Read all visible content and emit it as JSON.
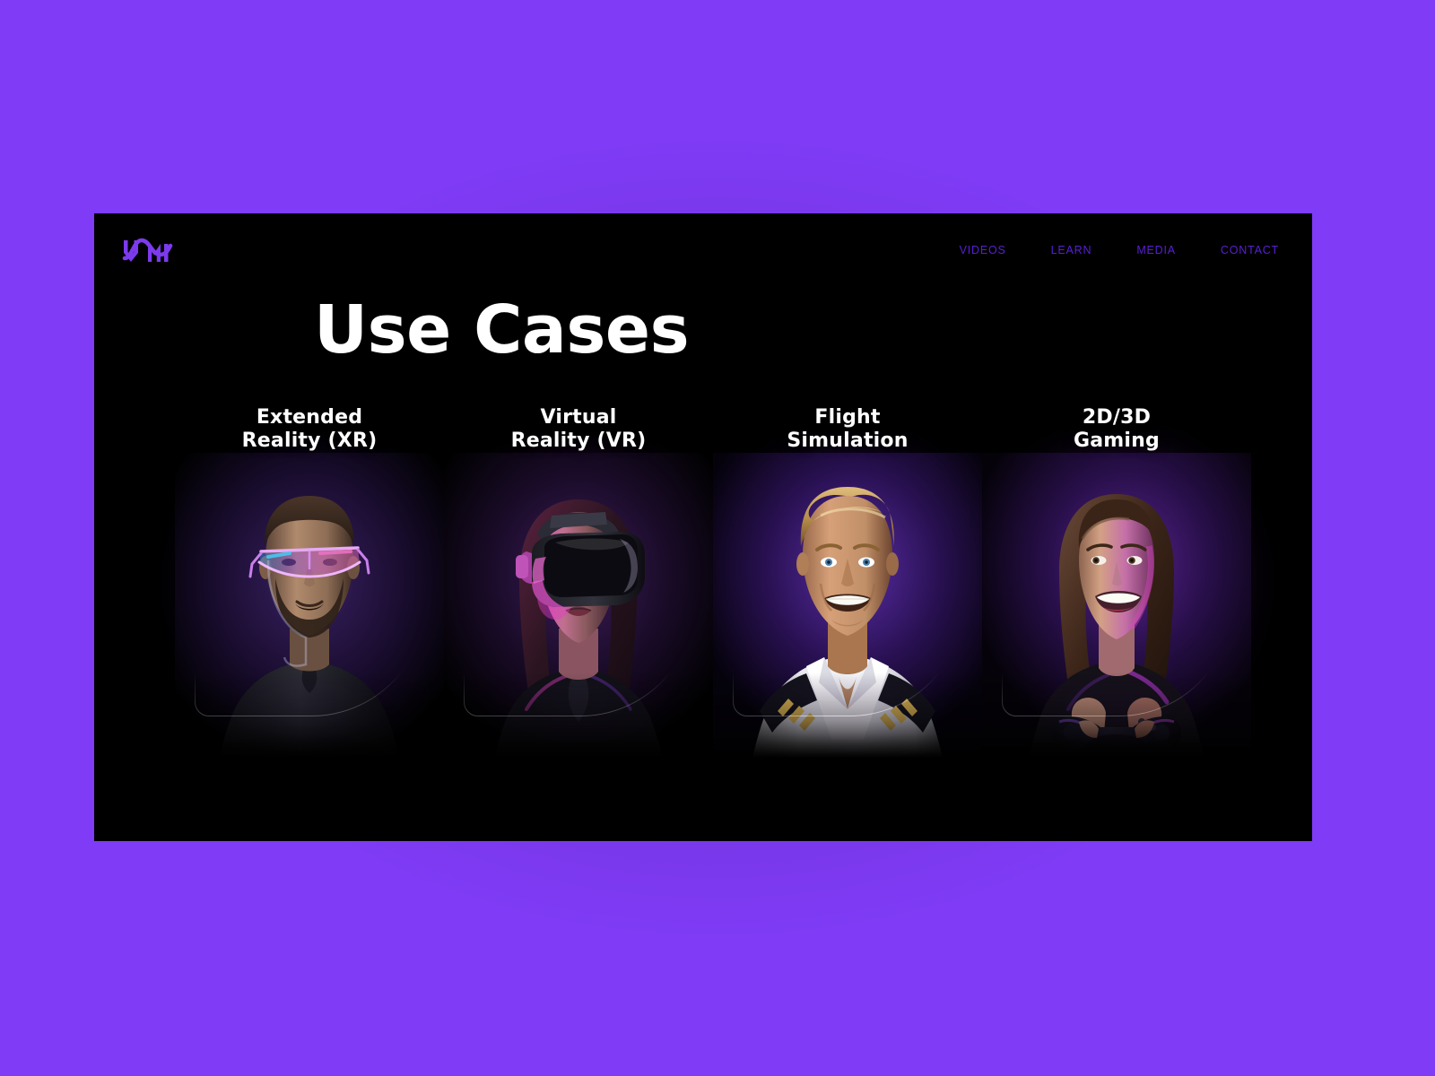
{
  "page": {
    "background_color": "#7f3bf5",
    "panel_color": "#000000"
  },
  "header": {
    "logo": {
      "icon": "vm-monogram-logo",
      "alt_text": "VM",
      "color": "#7c3aed"
    },
    "nav": {
      "accent_color": "#5a1fd6",
      "items": [
        {
          "label": "VIDEOS",
          "name": "nav-link-videos"
        },
        {
          "label": "LEARN",
          "name": "nav-link-learn"
        },
        {
          "label": "MEDIA",
          "name": "nav-link-media"
        },
        {
          "label": "CONTACT",
          "name": "nav-link-contact"
        }
      ]
    }
  },
  "main": {
    "title": "Use Cases",
    "title_color": "#ffffff",
    "cards": [
      {
        "title_line1": "Extended",
        "title_line2": "Reality (XR)",
        "image_alt": "bearded man wearing glowing AR smart glasses",
        "glow_color": "#3b1f6e",
        "accent_color": "#b05cf0"
      },
      {
        "title_line1": "Virtual",
        "title_line2": "Reality (VR)",
        "image_alt": "woman wearing a black VR headset lit with magenta light",
        "glow_color": "#4a1a63",
        "accent_color": "#e040c8"
      },
      {
        "title_line1": "Flight",
        "title_line2": "Simulation",
        "image_alt": "smiling blond pilot in white uniform shirt with epaulettes",
        "glow_color": "#43207f",
        "accent_color": "#e8b64c"
      },
      {
        "title_line1": "2D/3D",
        "title_line2": "Gaming",
        "image_alt": "smiling young woman holding a game controller",
        "glow_color": "#4d1f7a",
        "accent_color": "#c445e8"
      }
    ]
  }
}
